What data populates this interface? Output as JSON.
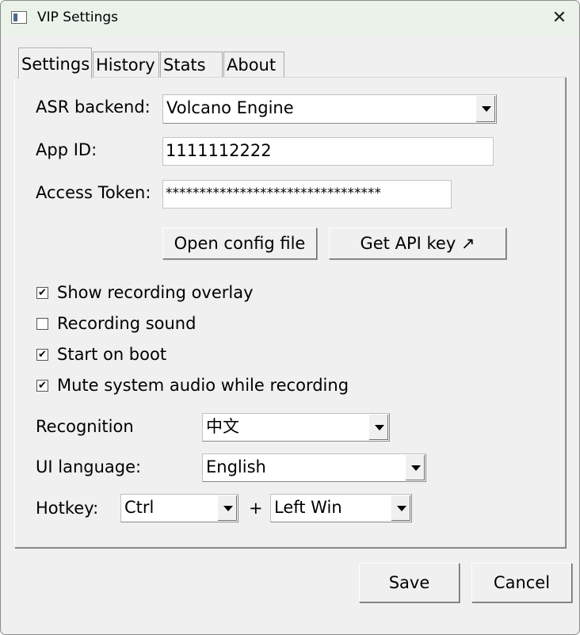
{
  "window": {
    "title": "VIP Settings",
    "close_glyph": "✕"
  },
  "tabs": [
    {
      "label": "Settings",
      "active": true
    },
    {
      "label": "History",
      "active": false
    },
    {
      "label": "Stats",
      "active": false
    },
    {
      "label": "About",
      "active": false
    }
  ],
  "settings": {
    "asr_label": "ASR backend:",
    "asr_value": "Volcano Engine",
    "app_id_label": "App ID:",
    "app_id_value": "1111112222",
    "token_label": "Access Token:",
    "token_value": "********************************",
    "open_config_label": "Open config file",
    "get_api_key_label": "Get API key ↗",
    "checkboxes": [
      {
        "label": "Show recording overlay",
        "checked": true,
        "mark": "✔"
      },
      {
        "label": "Recording sound",
        "checked": false,
        "mark": ""
      },
      {
        "label": "Start on boot",
        "checked": true,
        "mark": "✔"
      },
      {
        "label": "Mute system audio while recording",
        "checked": true,
        "mark": "✔"
      }
    ],
    "recognition_label": "Recognition",
    "recognition_value": "中文",
    "ui_language_label": "UI language:",
    "ui_language_value": "English",
    "hotkey_label": "Hotkey:",
    "hotkey_modifier": "Ctrl",
    "hotkey_plus": "+",
    "hotkey_key": "Left Win"
  },
  "footer": {
    "save_label": "Save",
    "cancel_label": "Cancel"
  }
}
